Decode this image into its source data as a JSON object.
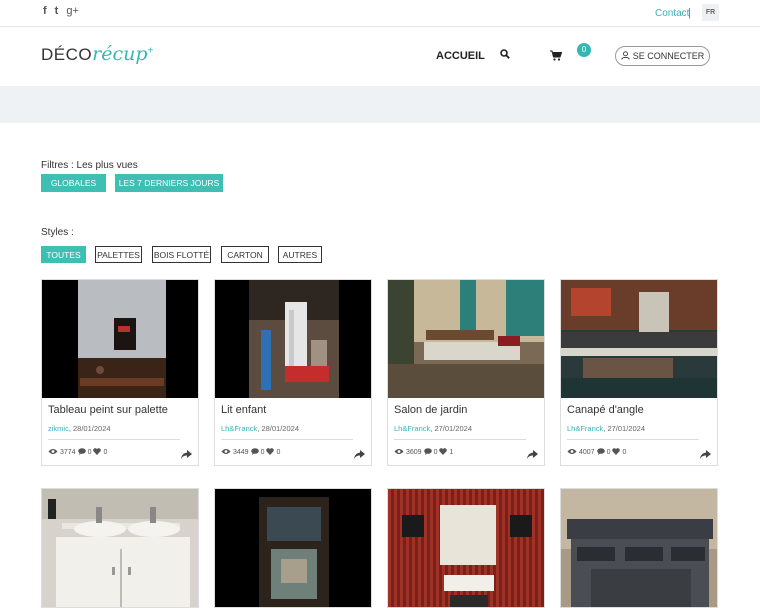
{
  "topbar": {
    "social": [
      {
        "icon": "facebook-icon",
        "glyph": "f"
      },
      {
        "icon": "twitter-icon",
        "glyph": "t"
      },
      {
        "icon": "googleplus-icon",
        "glyph": "g+"
      }
    ],
    "contact": "Contact",
    "separator": "|",
    "lang": "FR"
  },
  "header": {
    "logo_deco": "DÉCO",
    "logo_recup": "récup",
    "logo_plus": "+",
    "nav_accueil": "ACCUEIL",
    "cart_count": "0",
    "login": "SE CONNECTER"
  },
  "filters": {
    "label": "Filtres : Les plus vues",
    "buttons": [
      "GLOBALES",
      "LES 7 DERNIERS JOURS"
    ]
  },
  "styles": {
    "label": "Styles :",
    "buttons": [
      "TOUTES",
      "PALETTES",
      "BOIS FLOTTÉ",
      "CARTON",
      "AUTRES"
    ],
    "active": "TOUTES"
  },
  "cards": [
    {
      "title": "Tableau peint sur palette",
      "author": "zikmic",
      "date": ", 28/01/2024",
      "views": "3774",
      "comments": "0",
      "likes": "0"
    },
    {
      "title": "Lit enfant",
      "author": "Lh&Franck",
      "date": ", 28/01/2024",
      "views": "3449",
      "comments": "0",
      "likes": "0"
    },
    {
      "title": "Salon de jardin",
      "author": "Lh&Franck",
      "date": ", 27/01/2024",
      "views": "3609",
      "comments": "0",
      "likes": "1"
    },
    {
      "title": "Canapé d'angle",
      "author": "Lh&Franck",
      "date": ", 27/01/2024",
      "views": "4007",
      "comments": "0",
      "likes": "0"
    }
  ],
  "colors": {
    "accent": "#3dbfb4",
    "band": "#eef2f4"
  }
}
